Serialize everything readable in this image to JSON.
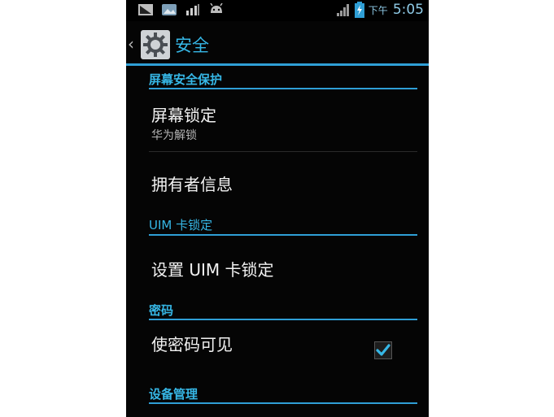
{
  "status_bar": {
    "ampm": "下午",
    "time": "5:05"
  },
  "action_bar": {
    "title": "安全"
  },
  "sections": [
    {
      "header": "屏幕安全保护",
      "items": [
        {
          "title": "屏幕锁定",
          "summary": "华为解锁"
        },
        {
          "title": "拥有者信息"
        }
      ]
    },
    {
      "header": "UIM 卡锁定",
      "items": [
        {
          "title": "设置 UIM 卡锁定"
        }
      ]
    },
    {
      "header": "密码",
      "items": [
        {
          "title": "使密码可见",
          "checked": true
        }
      ]
    },
    {
      "header": "设备管理",
      "items": []
    }
  ],
  "colors": {
    "accent": "#36b7e6",
    "divider": "#2f9fd6",
    "background": "#050505"
  }
}
